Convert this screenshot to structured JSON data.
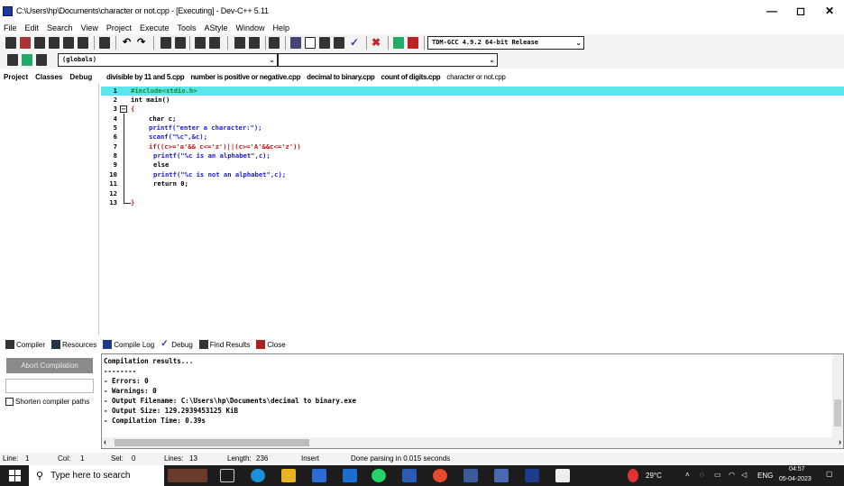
{
  "window": {
    "title": "C:\\Users\\hp\\Documents\\character or not.cpp - [Executing] - Dev-C++ 5.11",
    "controls": {
      "minimize": "—",
      "maximize": "◻",
      "close": "✕"
    }
  },
  "menu": [
    "File",
    "Edit",
    "Search",
    "View",
    "Project",
    "Execute",
    "Tools",
    "AStyle",
    "Window",
    "Help"
  ],
  "toolbar": {
    "compiler_select": "TDM-GCC 4.9.2 64-bit Release",
    "scope_select": "(globals)",
    "function_select": ""
  },
  "left_tabs": [
    "Project",
    "Classes",
    "Debug"
  ],
  "editor_tabs": [
    "divisible by 11 and 5.cpp",
    "number is positive or negative.cpp",
    "decimal to binary.cpp",
    "count of digits.cpp",
    "character or not.cpp"
  ],
  "code": [
    {
      "n": "1",
      "text": "#include<stdio.h>"
    },
    {
      "n": "2",
      "text": "int main()"
    },
    {
      "n": "3",
      "text": "{"
    },
    {
      "n": "4",
      "text": "char c;"
    },
    {
      "n": "5",
      "text": "printf(\"enter a character:\");"
    },
    {
      "n": "6",
      "text": "scanf(\"%c\",&c);"
    },
    {
      "n": "7",
      "text": "if((c>='a'&& c<='z')||(c>='A'&&c<='z'))"
    },
    {
      "n": "8",
      "text": "printf(\"%c is an alphabet\",c);"
    },
    {
      "n": "9",
      "text": "else"
    },
    {
      "n": "10",
      "text": "printf(\"%c is not an alphabet\",c);"
    },
    {
      "n": "11",
      "text": "return 0;"
    },
    {
      "n": "12",
      "text": ""
    },
    {
      "n": "13",
      "text": "}"
    }
  ],
  "bottom_tabs": [
    "Compiler",
    "Resources",
    "Compile Log",
    "Debug",
    "Find Results",
    "Close"
  ],
  "compile_panel": {
    "abort_label": "Abort Compilation",
    "shorten_label": "Shorten compiler paths",
    "output": [
      "Compilation results...",
      "--------",
      "- Errors: 0",
      "- Warnings: 0",
      "- Output Filename: C:\\Users\\hp\\Documents\\decimal to binary.exe",
      "- Output Size: 129.2939453125 KiB",
      "- Compilation Time: 0.39s"
    ]
  },
  "status": {
    "line_label": "Line:",
    "line": "1",
    "col_label": "Col:",
    "col": "1",
    "sel_label": "Sel:",
    "sel": "0",
    "lines_label": "Lines:",
    "lines": "13",
    "length_label": "Length:",
    "length": "236",
    "mode": "Insert",
    "message": "Done parsing in 0.015 seconds"
  },
  "taskbar": {
    "search_placeholder": "Type here to search",
    "temperature": "29°C",
    "language": "ENG",
    "time": "04:57",
    "date": "05-04-2023"
  },
  "colors": {
    "highlight_line": "#5ae6ec",
    "keyword_red": "#d01010",
    "string_blue": "#1a1ad0",
    "preprocessor_green": "#1a8a1a"
  }
}
